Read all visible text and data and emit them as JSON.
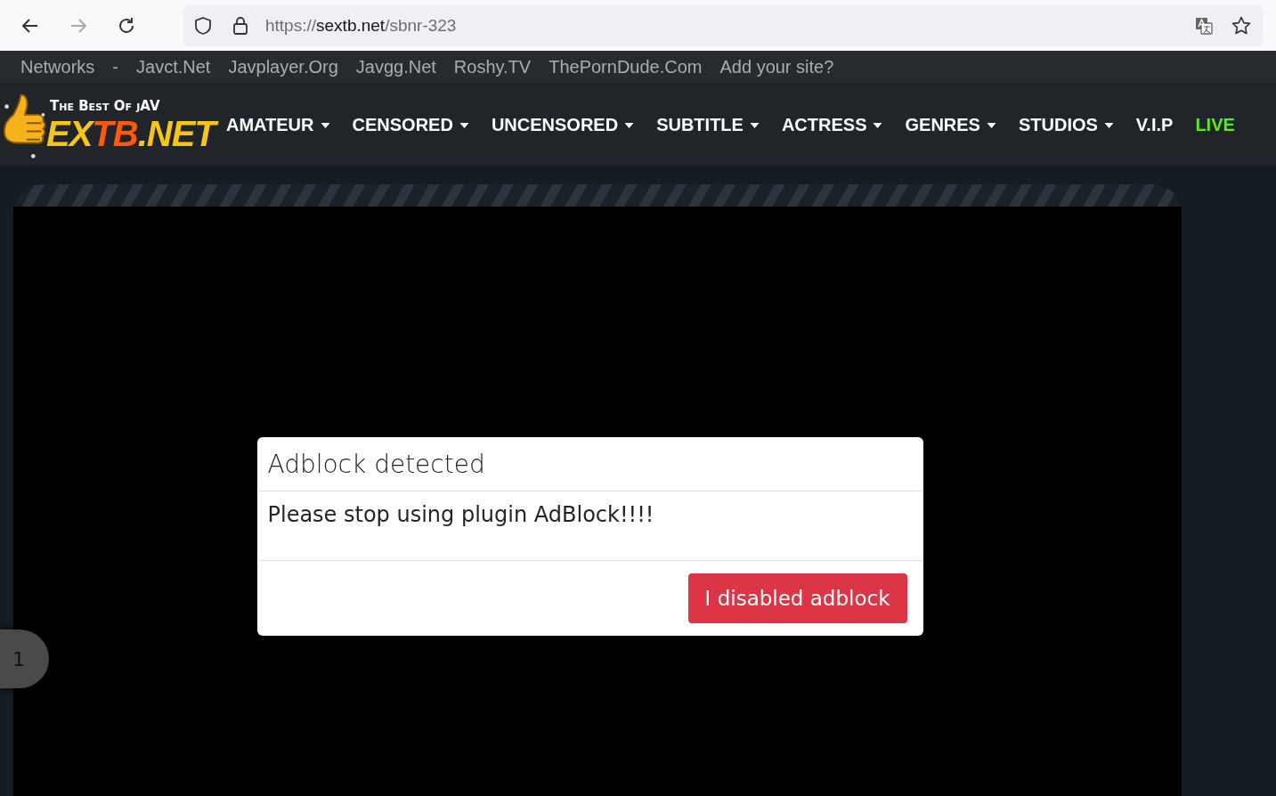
{
  "browser": {
    "url": {
      "scheme": "https://",
      "host": "sextb.net",
      "path": "/sbnr-323"
    }
  },
  "network_bar": {
    "title": "Networks",
    "separator": "-",
    "links": [
      "Javct.Net",
      "Javplayer.Org",
      "Javgg.Net",
      "Roshy.TV",
      "ThePornDude.Com",
      "Add your site?"
    ]
  },
  "logo": {
    "tagline": "The Best Of jAV",
    "brand": [
      {
        "text": "EX",
        "color": "#f5c518"
      },
      {
        "text": "TB",
        "color": "#ff5a0a"
      },
      {
        "text": ".NET",
        "color": "#f5c518"
      }
    ]
  },
  "nav": [
    {
      "label": "AMATEUR",
      "kind": "dropdown"
    },
    {
      "label": "CENSORED",
      "kind": "dropdown"
    },
    {
      "label": "UNCENSORED",
      "kind": "dropdown"
    },
    {
      "label": "SUBTITLE",
      "kind": "dropdown"
    },
    {
      "label": "ACTRESS",
      "kind": "dropdown"
    },
    {
      "label": "GENRES",
      "kind": "dropdown"
    },
    {
      "label": "STUDIOS",
      "kind": "dropdown"
    },
    {
      "label": "V.I.P",
      "kind": "plain"
    },
    {
      "label": "LIVE",
      "kind": "live"
    }
  ],
  "modal": {
    "title": "Adblock detected",
    "message": "Please stop using plugin AdBlock!!!!",
    "button": "I disabled adblock"
  },
  "side_tab": {
    "label": "1"
  }
}
